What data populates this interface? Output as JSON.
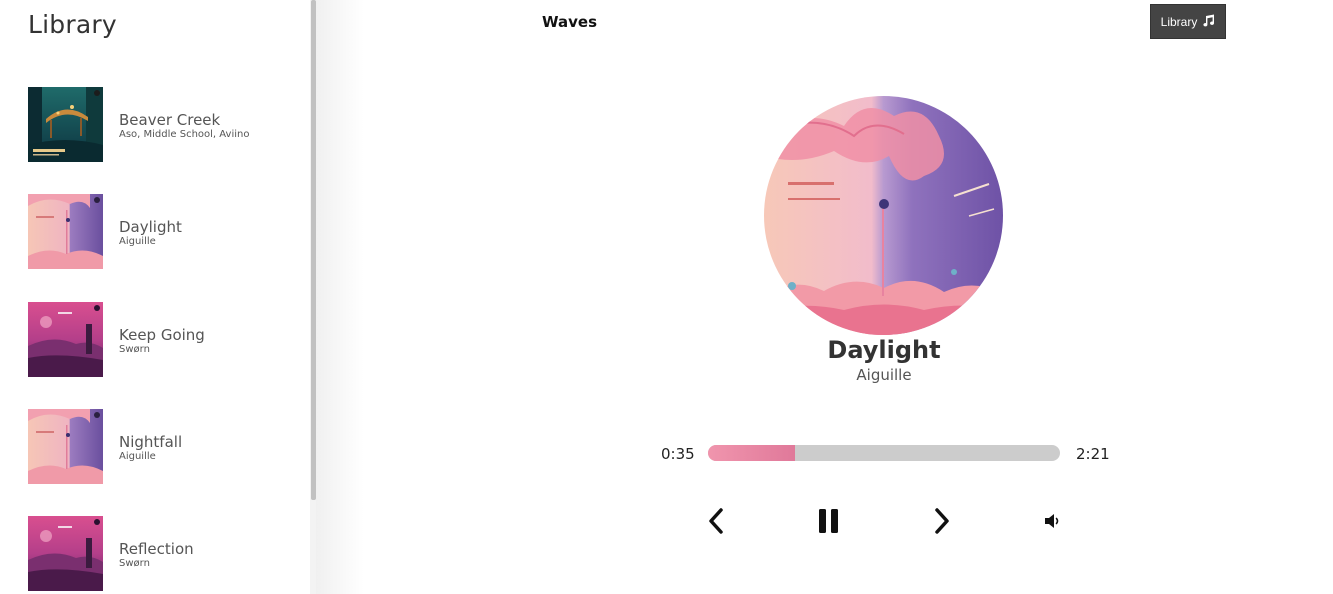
{
  "sidebar": {
    "title": "Library",
    "songs": [
      {
        "name": "Beaver Creek",
        "artist": "Aso, Middle School, Aviino",
        "art": "forest"
      },
      {
        "name": "Daylight",
        "artist": "Aiguille",
        "art": "daylight"
      },
      {
        "name": "Keep Going",
        "artist": "Swørn",
        "art": "sunset"
      },
      {
        "name": "Nightfall",
        "artist": "Aiguille",
        "art": "daylight"
      },
      {
        "name": "Reflection",
        "artist": "Swørn",
        "art": "sunset"
      }
    ]
  },
  "nav": {
    "title": "Waves",
    "library_button": "Library",
    "library_icon": "music-note-icon"
  },
  "player": {
    "title": "Daylight",
    "artist": "Aiguille",
    "current_time": "0:35",
    "total_time": "2:21",
    "progress_fraction": 0.248,
    "cover_art": "daylight",
    "controls": {
      "prev_icon": "chevron-left-icon",
      "play_pause_icon": "pause-icon",
      "next_icon": "chevron-right-icon",
      "volume_icon": "volume-icon"
    }
  },
  "colors": {
    "accent": "#e88ba5",
    "button_bg": "#444444",
    "progress_track": "#cccccc"
  }
}
